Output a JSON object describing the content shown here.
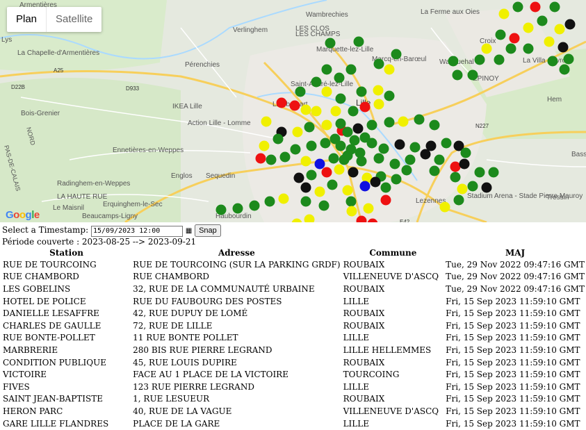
{
  "map": {
    "maptype": {
      "plan": "Plan",
      "satellite": "Satellite"
    },
    "labels": [
      "Armentières",
      "Wambrechies",
      "La Ferme aux Oies",
      "Verlinghem",
      "LES CLOS",
      "LES CHAMPS",
      "Lys",
      "La Chapelle-d'Armentières",
      "Marquette-lez-Lille",
      "Marcq-en-Barœul",
      "Wasquehal",
      "Croix",
      "La Villa Cavrois",
      "A25",
      "Pérenchies",
      "Saint-André-lez-Lille",
      "D22B",
      "D933",
      "Lambersart",
      "Lille",
      "IKEA Lille",
      "Action Lille - Lomme",
      "Bois-Grenier",
      "NORD",
      "PAS-DE-CALAIS",
      "Ennetières-en-Weppes",
      "Englos",
      "Sequedin",
      "Radinghem-en-Weppes",
      "LA HAUTE RUE",
      "Le Maisnil",
      "Erquinghem-le-Sec",
      "Beaucamps-Ligny",
      "Haubourdin",
      "Hem",
      "N227",
      "Lezennes",
      "Stadium Arena - Stade Pierre Mauroy",
      "Tressin",
      "Basse",
      "E42",
      "ÉPINOY"
    ],
    "colors": {
      "green": "#1c8a1c",
      "yellow": "#f0f000",
      "red": "#ee1111",
      "black": "#111111",
      "blue": "#1010e0"
    },
    "google": "Google"
  },
  "controls": {
    "label": "Select a Timestamp:",
    "timestamp": "15/09/2023 12:00",
    "snap": "Snap"
  },
  "periode": "Période couverte : 2023-08-25 --> 2023-09-21",
  "table": {
    "headers": [
      "Station",
      "Adresse",
      "Commune",
      "MAJ"
    ],
    "rows": [
      [
        "RUE DE TOURCOING",
        "RUE DE TOURCOING (SUR LA PARKING GRDF)",
        "ROUBAIX",
        "Tue, 29 Nov 2022 09:47:16 GMT"
      ],
      [
        "RUE CHAMBORD",
        "RUE CHAMBORD",
        "VILLENEUVE D'ASCQ",
        "Tue, 29 Nov 2022 09:47:16 GMT"
      ],
      [
        "LES GOBELINS",
        "32, RUE DE LA COMMUNAUTÉ URBAINE",
        "ROUBAIX",
        "Tue, 29 Nov 2022 09:47:16 GMT"
      ],
      [
        "HOTEL DE POLICE",
        "RUE DU FAUBOURG DES POSTES",
        "LILLE",
        "Fri, 15 Sep 2023 11:59:10 GMT"
      ],
      [
        "DANIELLE LESAFFRE",
        "42, RUE DUPUY DE LOMÉ",
        "ROUBAIX",
        "Fri, 15 Sep 2023 11:59:10 GMT"
      ],
      [
        "CHARLES DE GAULLE",
        "72, RUE DE LILLE",
        "ROUBAIX",
        "Fri, 15 Sep 2023 11:59:10 GMT"
      ],
      [
        "RUE BONTE-POLLET",
        "11 RUE BONTE POLLET",
        "LILLE",
        "Fri, 15 Sep 2023 11:59:10 GMT"
      ],
      [
        "MARBRERIE",
        "280 BIS RUE PIERRE LEGRAND",
        "LILLE HELLEMMES",
        "Fri, 15 Sep 2023 11:59:10 GMT"
      ],
      [
        "CONDITION PUBLIQUE",
        "45, RUE LOUIS DUPIRE",
        "ROUBAIX",
        "Fri, 15 Sep 2023 11:59:10 GMT"
      ],
      [
        "VICTOIRE",
        "FACE AU 1 PLACE DE LA VICTOIRE",
        "TOURCOING",
        "Fri, 15 Sep 2023 11:59:10 GMT"
      ],
      [
        "FIVES",
        "123 RUE PIERRE LEGRAND",
        "LILLE",
        "Fri, 15 Sep 2023 11:59:10 GMT"
      ],
      [
        "SAINT JEAN-BAPTISTE",
        "1, RUE LESUEUR",
        "ROUBAIX",
        "Fri, 15 Sep 2023 11:59:10 GMT"
      ],
      [
        "HERON PARC",
        "40, RUE DE LA VAGUE",
        "VILLENEUVE D'ASCQ",
        "Fri, 15 Sep 2023 11:59:10 GMT"
      ],
      [
        "GARE LILLE FLANDRES",
        "PLACE DE LA GARE",
        "LILLE",
        "Fri, 15 Sep 2023 11:59:10 GMT"
      ]
    ]
  }
}
